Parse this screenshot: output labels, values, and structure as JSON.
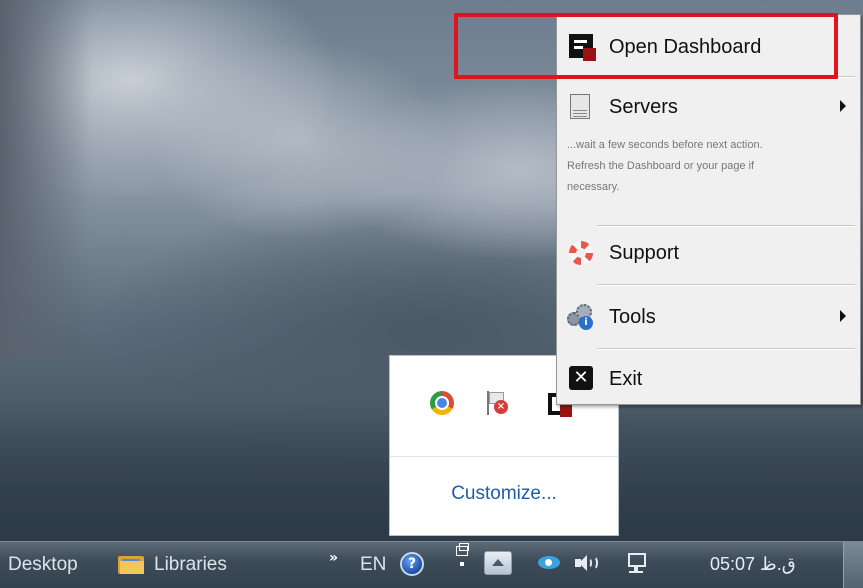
{
  "context_menu": {
    "items": [
      {
        "label": "Open Dashboard",
        "icon": "dashboard-icon",
        "has_submenu": false
      },
      {
        "label": "Servers",
        "icon": "server-icon",
        "has_submenu": true
      },
      {
        "label": "Support",
        "icon": "lifebuoy-icon",
        "has_submenu": false
      },
      {
        "label": "Tools",
        "icon": "tools-gear-icon",
        "has_submenu": true
      },
      {
        "label": "Exit",
        "icon": "close-icon",
        "has_submenu": false
      }
    ],
    "hint_lines": [
      "...wait a few seconds before next action.",
      "Refresh the Dashboard or your page if",
      "necessary."
    ],
    "highlight_color": "#e0141e"
  },
  "tray_popup": {
    "icons": [
      "chrome-icon",
      "action-center-flag-icon",
      "dashboard-app-icon"
    ],
    "customize_label": "Customize..."
  },
  "taskbar": {
    "toolbar_desktop": "Desktop",
    "toolbar_libraries": "Libraries",
    "overflow_chevron": "»",
    "language": "EN",
    "help_glyph": "?",
    "clock": "05:07 ق.ظ"
  }
}
